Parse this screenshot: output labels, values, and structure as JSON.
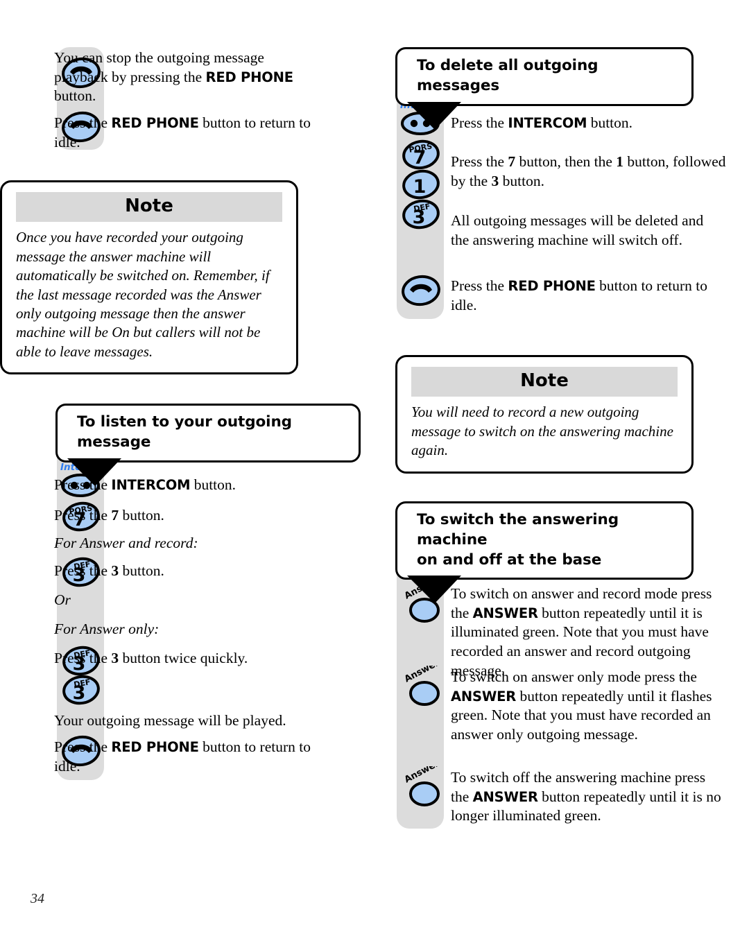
{
  "page": {
    "number": "34",
    "colors": {
      "rail_gray": "#dcdcdc",
      "button_blue": "#a9cdf5",
      "note_band_gray": "#d9d9d9",
      "intercom_label_blue": "#2f7ef0"
    }
  },
  "left_column": {
    "intro_steps": [
      {
        "icon": "red-phone-button",
        "text_parts": [
          {
            "t": "You can stop the outgoing message playback by pressing the ",
            "b": false
          },
          {
            "t": "RED PHONE",
            "b": true
          },
          {
            "t": " button.",
            "b": false
          }
        ],
        "plain": "You can stop the outgoing message playback by pressing the RED PHONE button."
      },
      {
        "icon": "red-phone-button",
        "plain": "Press the RED PHONE button to return to idle."
      }
    ],
    "note": {
      "title": "Note",
      "body": "Once you have recorded your outgoing message the answer machine will automatically be switched on. Remember, if the last message recorded was the Answer only outgoing message then the answer machine will be On but callers will not be able to leave messages."
    },
    "section": {
      "heading": "To listen to your outgoing message",
      "steps": [
        {
          "icon": "intercom-button",
          "icon_label": "Intercom",
          "text": "Press the INTERCOM button.",
          "bold": "INTERCOM"
        },
        {
          "icon": "key-7",
          "key_letters": "PQRS",
          "key_digit": "7",
          "text": "Press the 7 button.",
          "bold": "7"
        },
        {
          "icon": null,
          "text": "For Answer and record:",
          "italic": true
        },
        {
          "icon": "key-3",
          "key_letters": "DEF",
          "key_digit": "3",
          "text": "Press the 3 button.",
          "bold": "3"
        },
        {
          "icon": null,
          "text": "Or",
          "italic": true
        },
        {
          "icon": null,
          "text": "For Answer only:",
          "italic": true
        },
        {
          "icon": "key-3",
          "key_letters": "DEF",
          "key_digit": "3",
          "text": "Press the 3 button twice quickly.",
          "bold": "3"
        },
        {
          "icon": "key-3",
          "key_letters": "DEF",
          "key_digit": "3",
          "text": ""
        },
        {
          "icon": null,
          "text": "Your outgoing message will be played."
        },
        {
          "icon": "red-phone-button",
          "text": "Press the RED PHONE button to return to idle.",
          "bold": "RED PHONE"
        }
      ]
    }
  },
  "right_column": {
    "section_delete": {
      "heading": "To delete all outgoing messages",
      "steps": [
        {
          "icon": "intercom-button",
          "icon_label": "Intercom",
          "text": "Press the INTERCOM button.",
          "bold": "INTERCOM"
        },
        {
          "icon": "key-7",
          "key_letters": "PQRS",
          "key_digit": "7",
          "text": "Press the 7 button, then the 1 button, followed by the 3 button."
        },
        {
          "icon": "key-1",
          "key_letters": "",
          "key_digit": "1",
          "text": ""
        },
        {
          "icon": "key-3",
          "key_letters": "DEF",
          "key_digit": "3",
          "text": "All outgoing messages will be deleted and the answering machine will switch off."
        },
        {
          "icon": "red-phone-button",
          "text": "Press the RED PHONE button to return to idle.",
          "bold": "RED PHONE"
        }
      ]
    },
    "note": {
      "title": "Note",
      "body": "You will need to record a new outgoing message to switch on the answering machine again."
    },
    "section_switch": {
      "heading_line1": "To switch the answering machine",
      "heading_line2": "on and off at the base",
      "steps": [
        {
          "icon": "answer-button",
          "icon_label": "Answer",
          "text": "To switch on answer and record mode press the ANSWER button repeatedly until it is illuminated green. Note that you must have recorded an answer and record outgoing message.",
          "bold": "ANSWER"
        },
        {
          "icon": "answer-button",
          "icon_label": "Answer",
          "text": "To switch on answer only mode press the ANSWER button repeatedly until it flashes green. Note that you must have recorded an answer only outgoing message.",
          "bold": "ANSWER"
        },
        {
          "icon": "answer-button",
          "icon_label": "Answer",
          "text": "To switch off the answering machine press the ANSWER button repeatedly until it is no longer illuminated green.",
          "bold": "ANSWER"
        }
      ]
    }
  },
  "text_fragments": {
    "l_intro1_a": "You can stop the outgoing message",
    "l_intro1_b": "playback by pressing the ",
    "l_intro1_bold": "RED PHONE",
    "l_intro1_c": "button.",
    "press_the": "Press the ",
    "red_phone": "RED PHONE",
    "button_to_return": " button to return to idle.",
    "intercom_sentence_pre": "Press the ",
    "intercom_word": "INTERCOM",
    "intercom_sentence_post": " button.",
    "press7_pre": "Press the ",
    "seven": "7",
    "press7_post": " button.",
    "for_answer_and_record": "For Answer and record:",
    "press3_post": " button.",
    "three": "3",
    "or": "Or",
    "for_answer_only": "For Answer only:",
    "press3_twice_post": " button twice quickly.",
    "outgoing_played": "Your outgoing message will be played.",
    "del_seq_pre": "Press the ",
    "del_seq_mid": " button, then the ",
    "one": "1",
    "del_seq_mid2": " button, followed by the ",
    "del_seq_post": " button.",
    "all_deleted": "All outgoing messages will be deleted and the answering machine will switch off.",
    "ans1_pre": "To switch on answer and record mode press the ",
    "answer_word": "ANSWER",
    "ans1_post": " button repeatedly until it is illuminated green. Note that you must have recorded an answer and record outgoing message.",
    "ans2_pre": "To switch on answer only mode press the ",
    "ans2_post": " button repeatedly until it flashes green. Note that you must have recorded an answer only outgoing message.",
    "ans3_pre": "To switch off the answering machine press the ",
    "ans3_post": " button repeatedly until it is no longer illuminated green."
  },
  "icons": {
    "red_phone": "red-phone-icon",
    "intercom": "intercom-icon",
    "key": "keypad-key-icon",
    "answer": "answer-icon"
  }
}
